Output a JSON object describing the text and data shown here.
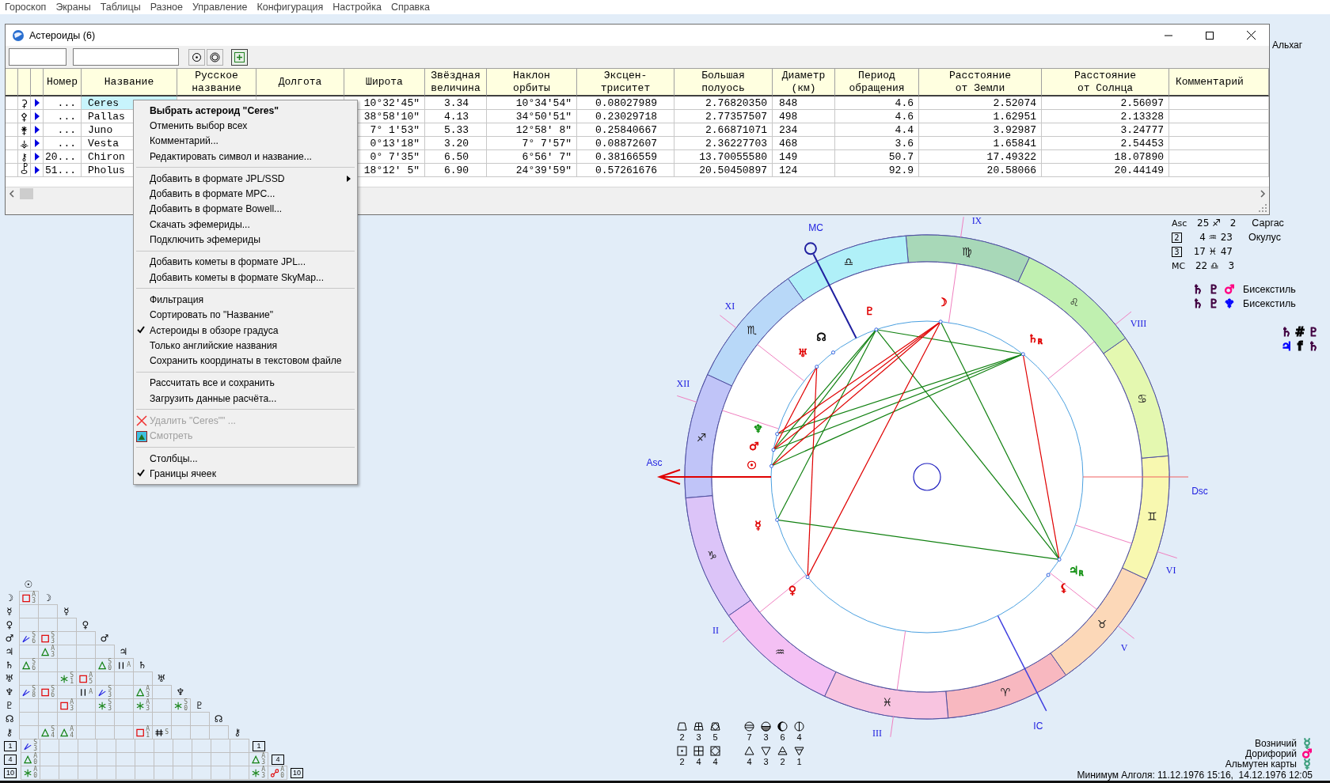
{
  "menubar": [
    "Гороскоп",
    "Экраны",
    "Таблицы",
    "Разное",
    "Управление",
    "Конфигурация",
    "Настройка",
    "Справка"
  ],
  "window": {
    "title": "Астероиды (6)",
    "columns": [
      "Номер",
      "Название",
      "Русское\nназвание",
      "Долгота",
      "Широта",
      "Звёздная\nвеличина",
      "Наклон\nорбиты",
      "Эксцен-\nтриситет",
      "Большая\nполуось",
      "Диаметр\n(км)",
      "Период\nобращения",
      "Расстояние\nот Земли",
      "Расстояние\nот Солнца",
      "Комментарий"
    ],
    "rows": [
      {
        "symbol": "⚳",
        "number": "...",
        "name": "Ceres",
        "selected": true,
        "latitude": "10°32'45\"",
        "magnitude": "3.34",
        "inclination": "10°34'54\"",
        "eccentricity": "0.08027989",
        "semi_axis": "2.76820350",
        "diameter": "848",
        "period": "4.6",
        "dist_earth": "2.52074",
        "dist_sun": "2.56097"
      },
      {
        "symbol": "⚴",
        "number": "...",
        "name": "Pallas",
        "selected": false,
        "latitude": "38°58'10\"",
        "magnitude": "4.13",
        "inclination": "34°50'51\"",
        "eccentricity": "0.23029718",
        "semi_axis": "2.77357507",
        "diameter": "498",
        "period": "4.6",
        "dist_earth": "1.62951",
        "dist_sun": "2.13328"
      },
      {
        "symbol": "⚵",
        "number": "...",
        "name": "Juno",
        "selected": false,
        "latitude": "7° 1'53\"",
        "magnitude": "5.33",
        "inclination": "12°58' 8\"",
        "eccentricity": "0.25840667",
        "semi_axis": "2.66871071",
        "diameter": "234",
        "period": "4.4",
        "dist_earth": "3.92987",
        "dist_sun": "3.24777"
      },
      {
        "symbol": "⚶",
        "number": "...",
        "name": "Vesta",
        "selected": false,
        "latitude": "0°13'18\"",
        "magnitude": "3.20",
        "inclination": "7° 7'57\"",
        "eccentricity": "0.08872607",
        "semi_axis": "2.36227703",
        "diameter": "468",
        "period": "3.6",
        "dist_earth": "1.65841",
        "dist_sun": "2.54453"
      },
      {
        "symbol": "⚷",
        "number": "20...",
        "name": "Chiron",
        "selected": false,
        "latitude": "0° 7'35\"",
        "magnitude": "6.50",
        "inclination": "6°56' 7\"",
        "eccentricity": "0.38166559",
        "semi_axis": "13.70055580",
        "diameter": "149",
        "period": "50.7",
        "dist_earth": "17.49322",
        "dist_sun": "18.07890"
      },
      {
        "symbol": "⯛",
        "number": "51...",
        "name": "Pholus",
        "selected": false,
        "latitude": "18°12' 5\"",
        "magnitude": "6.90",
        "inclination": "24°39'59\"",
        "eccentricity": "0.57261676",
        "semi_axis": "20.50450897",
        "diameter": "124",
        "period": "92.9",
        "dist_earth": "20.58066",
        "dist_sun": "20.44149"
      }
    ]
  },
  "context_menu": [
    [
      {
        "kind": "plain",
        "label": "Выбрать астероид \"Ceres\"",
        "default": true,
        "checked": false,
        "disabled": false,
        "submenu": false
      },
      {
        "kind": "plain",
        "label": "Отменить выбор всех",
        "default": false,
        "checked": false,
        "disabled": false,
        "submenu": false
      },
      {
        "kind": "plain",
        "label": "Комментарий...",
        "default": false,
        "checked": false,
        "disabled": false,
        "submenu": false
      },
      {
        "kind": "plain",
        "label": "Редактировать символ и название...",
        "default": false,
        "checked": false,
        "disabled": false,
        "submenu": false
      }
    ],
    [
      {
        "kind": "plain",
        "label": "Добавить в формате JPL/SSD",
        "default": false,
        "checked": false,
        "disabled": false,
        "submenu": true
      },
      {
        "kind": "plain",
        "label": "Добавить в формате MPC...",
        "default": false,
        "checked": false,
        "disabled": false,
        "submenu": false
      },
      {
        "kind": "plain",
        "label": "Добавить в формате Bowell...",
        "default": false,
        "checked": false,
        "disabled": false,
        "submenu": false
      },
      {
        "kind": "plain",
        "label": "Скачать эфемериды...",
        "default": false,
        "checked": false,
        "disabled": false,
        "submenu": false
      },
      {
        "kind": "plain",
        "label": "Подключить эфемериды",
        "default": false,
        "checked": false,
        "disabled": false,
        "submenu": false
      }
    ],
    [
      {
        "kind": "plain",
        "label": "Добавить кометы в формате JPL...",
        "default": false,
        "checked": false,
        "disabled": false,
        "submenu": false
      },
      {
        "kind": "plain",
        "label": "Добавить кометы в формате SkyMap...",
        "default": false,
        "checked": false,
        "disabled": false,
        "submenu": false
      }
    ],
    [
      {
        "kind": "plain",
        "label": "Фильтрация",
        "default": false,
        "checked": false,
        "disabled": false,
        "submenu": false
      },
      {
        "kind": "plain",
        "label": "Сортировать по \"Название\"",
        "default": false,
        "checked": false,
        "disabled": false,
        "submenu": false
      },
      {
        "kind": "plain",
        "label": "Астероиды в обзоре градуса",
        "default": false,
        "checked": true,
        "disabled": false,
        "submenu": false
      },
      {
        "kind": "plain",
        "label": "Только английские названия",
        "default": false,
        "checked": false,
        "disabled": false,
        "submenu": false
      },
      {
        "kind": "plain",
        "label": "Сохранить координаты в текстовом файле",
        "default": false,
        "checked": false,
        "disabled": false,
        "submenu": false
      }
    ],
    [
      {
        "kind": "plain",
        "label": "Рассчитать все и сохранить",
        "default": false,
        "checked": false,
        "disabled": false,
        "submenu": false
      },
      {
        "kind": "plain",
        "label": "Загрузить данные расчёта...",
        "default": false,
        "checked": false,
        "disabled": false,
        "submenu": false
      }
    ],
    [
      {
        "kind": "delete",
        "label": "Удалить \"Ceres\"\" ...",
        "default": false,
        "checked": false,
        "disabled": true,
        "submenu": false
      },
      {
        "kind": "view",
        "label": "Смотреть",
        "default": false,
        "checked": false,
        "disabled": true,
        "submenu": false
      }
    ],
    [
      {
        "kind": "plain",
        "label": "Столбцы...",
        "default": false,
        "checked": false,
        "disabled": false,
        "submenu": false
      },
      {
        "kind": "plain",
        "label": "Границы ячеек",
        "default": false,
        "checked": true,
        "disabled": false,
        "submenu": false
      }
    ]
  ],
  "side_star": "Альхаг",
  "cusps": [
    {
      "label": "Asc",
      "kind": "text",
      "degree": "25",
      "sign": "♐",
      "minute": "2",
      "star": "Саргас"
    },
    {
      "label": "2",
      "kind": "box",
      "degree": "4",
      "sign": "♒",
      "minute": "23",
      "star": "Окулус"
    },
    {
      "label": "3",
      "kind": "box",
      "degree": "17",
      "sign": "♓",
      "minute": "47"
    },
    {
      "label": "MC",
      "kind": "text",
      "degree": "22",
      "sign": "♎",
      "minute": "3"
    }
  ],
  "configurations": [
    {
      "glyphs": [
        {
          "glyph": "♄",
          "color": "#400040"
        },
        {
          "glyph": "♇",
          "color": "#400040"
        },
        {
          "glyph": "♂",
          "color": "#ff0080"
        }
      ],
      "label": "Бисекстиль"
    },
    {
      "glyphs": [
        {
          "glyph": "♄",
          "color": "#400040"
        },
        {
          "glyph": "♇",
          "color": "#400040"
        },
        {
          "glyph": "♆",
          "color": "#0000ff"
        }
      ],
      "label": "Бисекстиль"
    }
  ],
  "pairs": [
    {
      "glyphs": [
        {
          "glyph": "♄",
          "color": "#400040"
        },
        {
          "glyph": "#",
          "color": "#000000"
        },
        {
          "glyph": "♇",
          "color": "#400040"
        }
      ]
    },
    {
      "glyphs": [
        {
          "glyph": "♃",
          "color": "#0000ff"
        },
        {
          "glyph": "f",
          "color": "#000000"
        },
        {
          "glyph": "♄",
          "color": "#400040"
        }
      ]
    }
  ],
  "chart": {
    "signs": [
      {
        "glyph": "♈",
        "color": "#f8b8c0"
      },
      {
        "glyph": "♉",
        "color": "#fcd8b8"
      },
      {
        "glyph": "♊",
        "color": "#f8f8b0"
      },
      {
        "glyph": "♋",
        "color": "#e4f8b0"
      },
      {
        "glyph": "♌",
        "color": "#c0f0b0"
      },
      {
        "glyph": "♍",
        "color": "#a8d8b8"
      },
      {
        "glyph": "♎",
        "color": "#b0f0f8"
      },
      {
        "glyph": "♏",
        "color": "#b8d8f8"
      },
      {
        "glyph": "♐",
        "color": "#c0c4f8"
      },
      {
        "glyph": "♑",
        "color": "#dcc4f8"
      },
      {
        "glyph": "♒",
        "color": "#f4c0f4"
      },
      {
        "glyph": "♓",
        "color": "#f8c4e0"
      }
    ],
    "houses": [
      "Asc",
      "II",
      "III",
      "IC",
      "V",
      "VI",
      "Dsc",
      "VIII",
      "IX",
      "MC",
      "XI",
      "XII"
    ],
    "planets": [
      {
        "glyph": "☽",
        "color": "#e00000"
      },
      {
        "glyph": "♇",
        "color": "#e00000"
      },
      {
        "glyph": "☊",
        "color": "#000000"
      },
      {
        "glyph": "♄",
        "color": "#e00000",
        "retro": "R"
      },
      {
        "glyph": "♅",
        "color": "#e00000"
      },
      {
        "glyph": "♆",
        "color": "#109010"
      },
      {
        "glyph": "♂",
        "color": "#e00000"
      },
      {
        "glyph": "☉",
        "color": "#e00000"
      },
      {
        "glyph": "☿",
        "color": "#e00000"
      },
      {
        "glyph": "♃",
        "color": "#109010",
        "retro": "R"
      },
      {
        "glyph": "⚸",
        "color": "#e00000"
      },
      {
        "glyph": "♀",
        "color": "#e00000"
      }
    ]
  },
  "aspect_grid": {
    "top_label": "☉",
    "rows": [
      {
        "label": "☽",
        "diagonal_label": "☽",
        "kind": "planet",
        "cells": [
          {
            "kind": "square",
            "tag": "A3"
          }
        ]
      },
      {
        "label": "☿",
        "diagonal_label": "☿",
        "kind": "planet",
        "cells": [
          {
            "kind": "none"
          },
          {
            "kind": "none"
          }
        ]
      },
      {
        "label": "♀",
        "diagonal_label": "♀",
        "kind": "planet",
        "cells": [
          {
            "kind": "none"
          },
          {
            "kind": "none"
          },
          {
            "kind": "none"
          }
        ]
      },
      {
        "label": "♂",
        "diagonal_label": "♂",
        "kind": "planet",
        "cells": [
          {
            "kind": "minor",
            "tag": "S6"
          },
          {
            "kind": "square",
            "tag": "S3"
          },
          {
            "kind": "none"
          },
          {
            "kind": "none"
          }
        ]
      },
      {
        "label": "♃",
        "diagonal_label": "♃",
        "kind": "planet",
        "cells": [
          {
            "kind": "none"
          },
          {
            "kind": "trine",
            "tag": "A3"
          },
          {
            "kind": "none"
          },
          {
            "kind": "none"
          },
          {
            "kind": "none"
          }
        ]
      },
      {
        "label": "♄",
        "diagonal_label": "♄",
        "kind": "planet",
        "cells": [
          {
            "kind": "trine",
            "tag": "S6"
          },
          {
            "kind": "none"
          },
          {
            "kind": "none"
          },
          {
            "kind": "none"
          },
          {
            "kind": "trine",
            "tag": "S0"
          },
          {
            "kind": "parallel",
            "tag": "A"
          }
        ]
      },
      {
        "label": "♅",
        "diagonal_label": "♅",
        "kind": "planet",
        "cells": [
          {
            "kind": "none"
          },
          {
            "kind": "none"
          },
          {
            "kind": "sextile",
            "tag": "S1"
          },
          {
            "kind": "square",
            "tag": "A5"
          },
          {
            "kind": "none"
          },
          {
            "kind": "none"
          },
          {
            "kind": "none"
          }
        ]
      },
      {
        "label": "♆",
        "diagonal_label": "♆",
        "kind": "planet",
        "cells": [
          {
            "kind": "minor",
            "tag": "S8"
          },
          {
            "kind": "square",
            "tag": "S6"
          },
          {
            "kind": "none"
          },
          {
            "kind": "parallel",
            "tag": "A"
          },
          {
            "kind": "minor",
            "tag": "S3"
          },
          {
            "kind": "none"
          },
          {
            "kind": "trine",
            "tag": "A3"
          },
          {
            "kind": "none"
          }
        ]
      },
      {
        "label": "♇",
        "diagonal_label": "♇",
        "kind": "planet",
        "cells": [
          {
            "kind": "none"
          },
          {
            "kind": "none"
          },
          {
            "kind": "square",
            "tag": "A3"
          },
          {
            "kind": "none"
          },
          {
            "kind": "sextile",
            "tag": "S3"
          },
          {
            "kind": "none"
          },
          {
            "kind": "sextile",
            "tag": "A3"
          },
          {
            "kind": "none"
          },
          {
            "kind": "sextile",
            "tag": "S0"
          }
        ]
      },
      {
        "label": "☊",
        "diagonal_label": "☊",
        "kind": "planet",
        "cells": [
          {
            "kind": "none"
          },
          {
            "kind": "none"
          },
          {
            "kind": "none"
          },
          {
            "kind": "none"
          },
          {
            "kind": "none"
          },
          {
            "kind": "none"
          },
          {
            "kind": "none"
          },
          {
            "kind": "none"
          },
          {
            "kind": "none"
          },
          {
            "kind": "none"
          }
        ]
      },
      {
        "label": "⚷",
        "diagonal_label": "⚷",
        "kind": "planet",
        "cells": [
          {
            "kind": "none"
          },
          {
            "kind": "trine",
            "tag": "S4"
          },
          {
            "kind": "trine",
            "tag": "A4"
          },
          {
            "kind": "none"
          },
          {
            "kind": "none"
          },
          {
            "kind": "none"
          },
          {
            "kind": "square",
            "tag": "A1"
          },
          {
            "kind": "contraparallel",
            "tag": "S"
          },
          {
            "kind": "none"
          },
          {
            "kind": "none"
          },
          {
            "kind": "none"
          }
        ]
      },
      {
        "label": "1",
        "diagonal_label": "1",
        "kind": "house",
        "cells": [
          {
            "kind": "minor",
            "tag": "S3"
          },
          {
            "kind": "none"
          },
          {
            "kind": "none"
          },
          {
            "kind": "none"
          },
          {
            "kind": "none"
          },
          {
            "kind": "none"
          },
          {
            "kind": "none"
          },
          {
            "kind": "none"
          },
          {
            "kind": "none"
          },
          {
            "kind": "none"
          },
          {
            "kind": "none"
          },
          {
            "kind": "none"
          }
        ]
      },
      {
        "label": "4",
        "diagonal_label": "4",
        "kind": "house",
        "cells": [
          {
            "kind": "trine",
            "tag": "A0"
          },
          {
            "kind": "none"
          },
          {
            "kind": "none"
          },
          {
            "kind": "none"
          },
          {
            "kind": "none"
          },
          {
            "kind": "none"
          },
          {
            "kind": "none"
          },
          {
            "kind": "none"
          },
          {
            "kind": "none"
          },
          {
            "kind": "none"
          },
          {
            "kind": "none"
          },
          {
            "kind": "none"
          },
          {
            "kind": "trine",
            "tag": "A3"
          }
        ]
      },
      {
        "label": "10",
        "diagonal_label": "10",
        "kind": "house",
        "cells": [
          {
            "kind": "sextile",
            "tag": "A0"
          },
          {
            "kind": "none"
          },
          {
            "kind": "none"
          },
          {
            "kind": "none"
          },
          {
            "kind": "none"
          },
          {
            "kind": "none"
          },
          {
            "kind": "none"
          },
          {
            "kind": "none"
          },
          {
            "kind": "none"
          },
          {
            "kind": "none"
          },
          {
            "kind": "none"
          },
          {
            "kind": "none"
          },
          {
            "kind": "sextile",
            "tag": "A3"
          },
          {
            "kind": "opposition",
            "tag": "A0"
          }
        ]
      }
    ]
  },
  "figures": {
    "left": [
      [
        {
          "kind": "trapezoid",
          "count": "2"
        },
        {
          "kind": "mill",
          "count": "3"
        },
        {
          "kind": "kite",
          "count": "5"
        }
      ],
      [
        {
          "kind": "dotbox",
          "count": "2"
        },
        {
          "kind": "grid",
          "count": "4"
        },
        {
          "kind": "diamond",
          "count": "4"
        }
      ]
    ],
    "right": [
      [
        {
          "kind": "circleline",
          "count": "7"
        },
        {
          "kind": "bowl",
          "count": "3"
        },
        {
          "kind": "crescent",
          "count": "6"
        },
        {
          "kind": "halfmoon",
          "count": "4"
        }
      ],
      [
        {
          "kind": "up",
          "count": "4"
        },
        {
          "kind": "down",
          "count": "3"
        },
        {
          "kind": "updot",
          "count": "2"
        },
        {
          "kind": "downline",
          "count": "1"
        }
      ]
    ]
  },
  "notes": [
    {
      "label": "Возничий",
      "glyph": "☿",
      "color": "#40a080"
    },
    {
      "label": "Дорифорий",
      "glyph": "♂",
      "color": "#ff0080"
    },
    {
      "label": "Альмутен карты",
      "glyph": "☿",
      "color": "#40a080"
    }
  ],
  "algol": "Минимум Алголя: 11.12.1976 15:16,  14.12.1976 12:05"
}
